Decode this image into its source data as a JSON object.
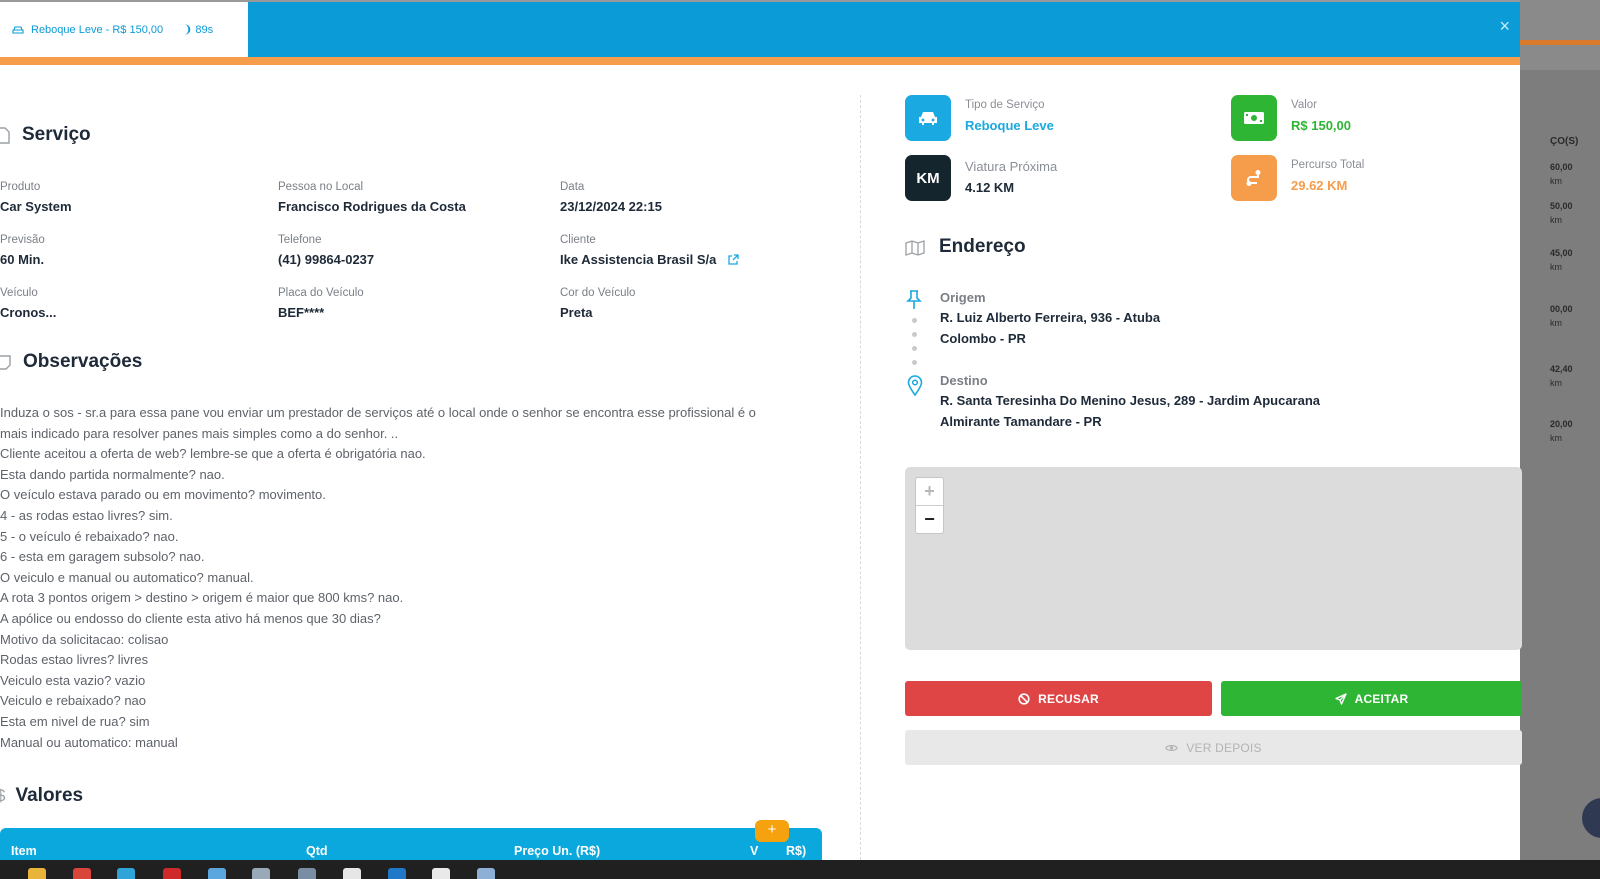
{
  "tab": {
    "label": "Reboque Leve  - R$ 150,00",
    "timer": "89s"
  },
  "close_label": "×",
  "servico": {
    "title": "Serviço",
    "fields": [
      {
        "label": "Produto",
        "value": "Car System"
      },
      {
        "label": "Pessoa no Local",
        "value": "Francisco Rodrigues da Costa"
      },
      {
        "label": "Data",
        "value": "23/12/2024 22:15"
      },
      {
        "label": "Previsão",
        "value": "60 Min."
      },
      {
        "label": "Telefone",
        "value": "(41) 99864-0237"
      },
      {
        "label": "Cliente",
        "value": "Ike Assistencia Brasil S/a"
      },
      {
        "label": "Veículo",
        "value": "Cronos..."
      },
      {
        "label": "Placa do Veículo",
        "value": "BEF****"
      },
      {
        "label": "Cor do Veículo",
        "value": "Preta"
      }
    ]
  },
  "observacoes": {
    "title": "Observações",
    "lines": [
      "Induza o sos - sr.a para essa pane vou enviar um prestador de serviços até o local onde o senhor se encontra esse profissional é o",
      "mais indicado para resolver panes mais simples como a do senhor. ..",
      "Cliente aceitou a oferta de web? lembre-se que a oferta é obrigatória nao.",
      "Esta dando partida normalmente? nao.",
      "O veículo estava parado ou em movimento? movimento.",
      "4 - as rodas estao livres? sim.",
      "5 - o veículo é rebaixado? nao.",
      "6 - esta em garagem subsolo? nao.",
      "O veiculo e manual ou automatico? manual.",
      "A rota 3 pontos origem > destino > origem é maior que 800 kms? nao.",
      "A apólice ou endosso do cliente esta ativo há menos que 30 dias?",
      "Motivo da solicitacao: colisao",
      "Rodas estao livres? livres",
      "Veiculo esta vazio? vazio",
      "Veiculo e rebaixado? nao",
      "Esta em nivel de rua? sim",
      "Manual ou automatico: manual"
    ]
  },
  "valores": {
    "title": "Valores",
    "columns": [
      "Item",
      "Qtd",
      "Preço Un. (R$)",
      "V",
      "R$)"
    ],
    "add_label": "+"
  },
  "cards": {
    "tipo": {
      "label": "Tipo de Serviço",
      "value": "Reboque Leve"
    },
    "valor": {
      "label": "Valor",
      "value": "R$ 150,00"
    },
    "viatura": {
      "label": "Viatura Próxima",
      "value": "4.12 KM",
      "icon_text": "KM"
    },
    "percurso": {
      "label": "Percurso Total",
      "value": "29.62 KM"
    }
  },
  "endereco": {
    "title": "Endereço",
    "origem": {
      "label": "Origem",
      "line1": "R. Luiz Alberto Ferreira, 936 - Atuba",
      "line2": "Colombo - PR"
    },
    "destino": {
      "label": "Destino",
      "line1": "R. Santa Teresinha Do Menino Jesus, 289 - Jardim Apucarana",
      "line2": "Almirante Tamandare - PR"
    }
  },
  "map": {
    "zoom_in": "+",
    "zoom_out": "−"
  },
  "buttons": {
    "recusar": "RECUSAR",
    "aceitar": "ACEITAR",
    "ver_depois": "VER DEPOIS"
  },
  "background": {
    "header": "ÇO(S)",
    "rows": [
      {
        "price": "60,00",
        "km": "km"
      },
      {
        "price": "50,00",
        "km": "km"
      },
      {
        "price": "45,00",
        "km": "km"
      },
      {
        "price": "00,00",
        "km": "km"
      },
      {
        "price": "42,40",
        "km": "km"
      },
      {
        "price": "20,00",
        "km": "km"
      }
    ]
  },
  "colors": {
    "header_blue": "#0b9bd7",
    "progress_orange": "#f59d4a",
    "tipo_blue": "#1aa9e0",
    "valor_green": "#2eb534",
    "viatura_dark": "#15252e",
    "percurso_orange": "#f59d4a",
    "recusar_red": "#e04545",
    "aceitar_green": "#2eb534"
  }
}
